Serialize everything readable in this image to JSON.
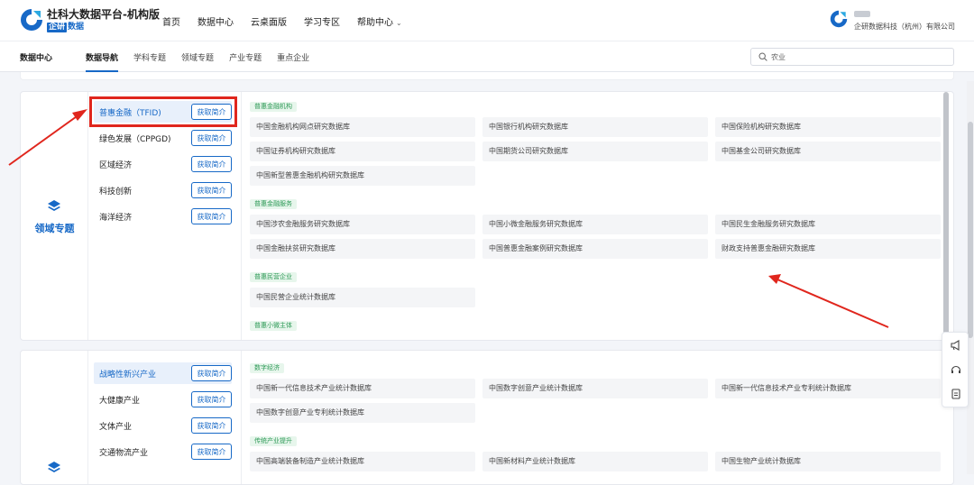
{
  "header": {
    "brand_title": "社科大数据平台-机构版",
    "brand_sub_boxed": "企研",
    "brand_sub_rest": "数据",
    "nav": [
      "首页",
      "数据中心",
      "云桌面版",
      "学习专区",
      "帮助中心"
    ],
    "org_name": "企研数据科技（杭州）有限公司"
  },
  "subnav": {
    "home": "数据中心",
    "items": [
      "数据导航",
      "学科专题",
      "领域专题",
      "产业专题",
      "重点企业"
    ],
    "active": "数据导航",
    "search_value": "农业"
  },
  "card1": {
    "side_label": "领域专题",
    "categories": [
      {
        "label": "普惠金融（TFID)",
        "btn": "获取简介"
      },
      {
        "label": "绿色发展（CPPGD)",
        "btn": "获取简介"
      },
      {
        "label": "区域经济",
        "btn": "获取简介"
      },
      {
        "label": "科技创新",
        "btn": "获取简介"
      },
      {
        "label": "海洋经济",
        "btn": "获取简介"
      }
    ],
    "groups": [
      {
        "tag": "普惠金融机构",
        "items": [
          "中国金融机构网点研究数据库",
          "中国银行机构研究数据库",
          "中国保险机构研究数据库",
          "中国证券机构研究数据库",
          "中国期货公司研究数据库",
          "中国基金公司研究数据库",
          "中国新型普惠金融机构研究数据库"
        ]
      },
      {
        "tag": "普惠金融服务",
        "items": [
          "中国涉农金融服务研究数据库",
          "中国小微金融服务研究数据库",
          "中国民生金融服务研究数据库",
          "中国金融扶贫研究数据库",
          "中国普惠金融案例研究数据库",
          "财政支持普惠金融研究数据库"
        ]
      },
      {
        "tag": "普惠民营企业",
        "items": [
          "中国民营企业统计数据库"
        ]
      },
      {
        "tag": "普惠小微主体",
        "items": []
      }
    ]
  },
  "card2": {
    "categories": [
      {
        "label": "战略性新兴产业",
        "btn": "获取简介"
      },
      {
        "label": "大健康产业",
        "btn": "获取简介"
      },
      {
        "label": "文体产业",
        "btn": "获取简介"
      },
      {
        "label": "交通物流产业",
        "btn": "获取简介"
      }
    ],
    "groups": [
      {
        "tag": "数字经济",
        "items": [
          "中国新一代信息技术产业统计数据库",
          "中国数字创意产业统计数据库",
          "中国新一代信息技术产业专利统计数据库",
          "中国数字创意产业专利统计数据库"
        ]
      },
      {
        "tag": "传统产业提升",
        "items": [
          "中国高端装备制造产业统计数据库",
          "中国新材料产业统计数据库",
          "中国生物产业统计数据库"
        ]
      }
    ]
  },
  "colors": {
    "accent": "#1769c7",
    "tag_bg": "#e7f6ec",
    "tag_text": "#2e9a57",
    "annotation": "#e0261d"
  }
}
